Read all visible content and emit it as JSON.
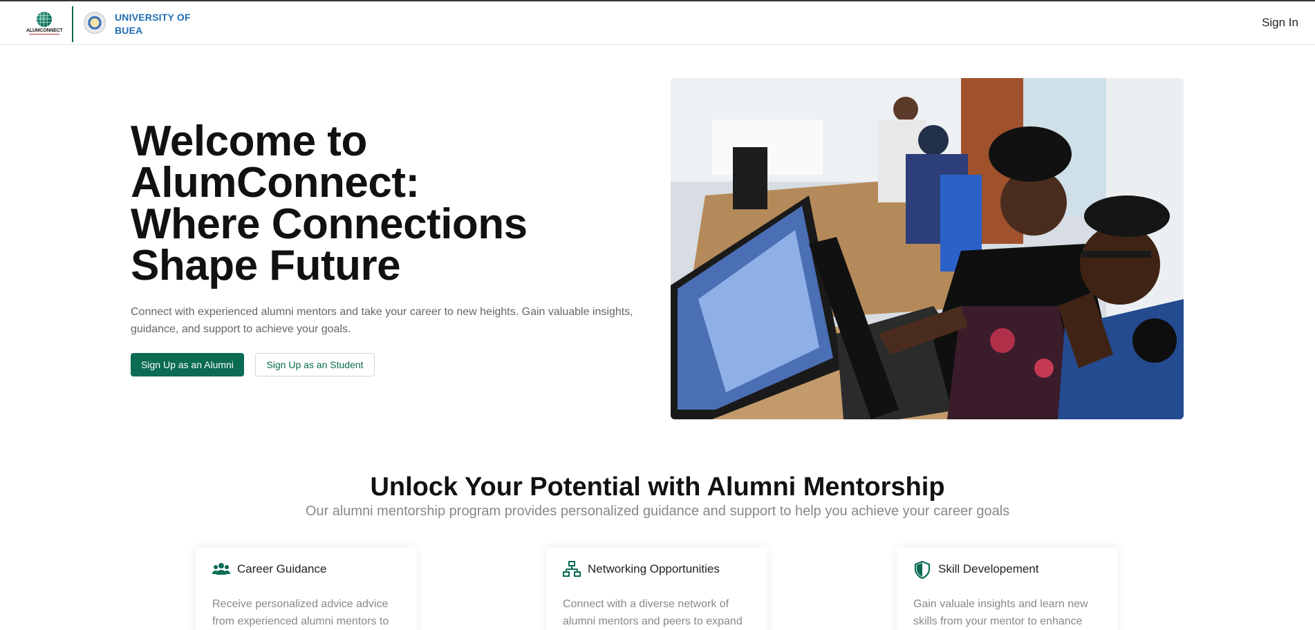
{
  "header": {
    "logo_wordmark": "ALUMCONNECT",
    "university_name": "UNIVERSITY OF BUEA",
    "signin_label": "Sign In"
  },
  "hero": {
    "title_lines": [
      "Welcome to",
      "AlumConnect:",
      "Where Connections",
      "Shape Future"
    ],
    "description": "Connect with experienced alumni mentors and take your career to new heights. Gain valuable insights, guidance, and support to achieve your goals.",
    "alumni_button": "Sign Up as an Alumni",
    "student_button": "Sign Up as an Student"
  },
  "section": {
    "title": "Unlock Your Potential with Alumni Mentorship",
    "subtitle": "Our alumni mentorship program provides personalized guidance and support to help you achieve your career goals"
  },
  "cards": [
    {
      "icon": "users-icon",
      "title": "Career Guidance",
      "text": "Receive personalized advice advice from experienced alumni mentors to"
    },
    {
      "icon": "network-icon",
      "title": "Networking Opportunities",
      "text": "Connect with a diverse network of alumni mentors and peers to expand"
    },
    {
      "icon": "shield-icon",
      "title": "Skill Developement",
      "text": "Gain valuale insights and learn new skills from your mentor to enhance"
    }
  ],
  "colors": {
    "brand_green": "#0b6b53",
    "university_blue": "#1f6db3"
  }
}
